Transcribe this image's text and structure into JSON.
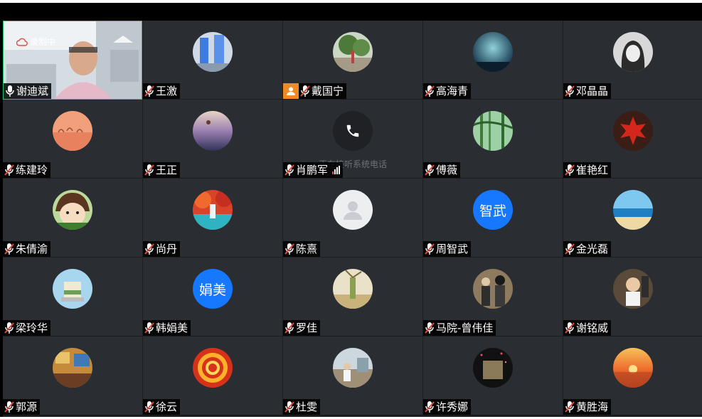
{
  "recording_label": "录制中",
  "calling_status": "正在接听系统电话",
  "participants": [
    {
      "name": "谢迪斌",
      "avatar": "camera-video",
      "speaker": true
    },
    {
      "name": "王激",
      "avatar": "photo-sculpture"
    },
    {
      "name": "戴国宁",
      "avatar": "photo-tree-runner",
      "host": true
    },
    {
      "name": "高海青",
      "avatar": "photo-galaxy"
    },
    {
      "name": "邓晶晶",
      "avatar": "photo-girl-bw"
    },
    {
      "name": "练建玲",
      "avatar": "photo-flamingos"
    },
    {
      "name": "王正",
      "avatar": "photo-balloon-sunset"
    },
    {
      "name": "肖鹏军",
      "avatar": "phone-call",
      "on_phone": true
    },
    {
      "name": "傅薇",
      "avatar": "photo-bamboo"
    },
    {
      "name": "崔艳红",
      "avatar": "photo-red-maple"
    },
    {
      "name": "朱倩渝",
      "avatar": "cartoon-girl"
    },
    {
      "name": "尚丹",
      "avatar": "photo-waterfall"
    },
    {
      "name": "陈熹",
      "avatar": "default-person"
    },
    {
      "name": "周智武",
      "avatar_text": "智武",
      "avatar_color": "#1677ff"
    },
    {
      "name": "金光磊",
      "avatar": "photo-beach"
    },
    {
      "name": "梁玲华",
      "avatar": "photo-cake"
    },
    {
      "name": "韩娟美",
      "avatar_text": "娟美",
      "avatar_color": "#1677ff"
    },
    {
      "name": "罗佳",
      "avatar": "photo-windmill"
    },
    {
      "name": "马院-曾伟佳",
      "avatar": "photo-figures"
    },
    {
      "name": "谢铭威",
      "avatar": "photo-child"
    },
    {
      "name": "郭源",
      "avatar": "photo-room"
    },
    {
      "name": "徐云",
      "avatar": "photo-fire-swirl"
    },
    {
      "name": "杜雯",
      "avatar": "photo-child-outdoor"
    },
    {
      "name": "许秀娜",
      "avatar": "photo-book-night"
    },
    {
      "name": "黄胜海",
      "avatar": "photo-sea-sunset"
    }
  ],
  "colors": {
    "tile_bg": "#2a2d32",
    "grid_bg": "#1b1d20",
    "speaker_border": "#23c26a",
    "muted_red": "#e24c3c",
    "host_orange": "#f08a24",
    "initials_blue": "#1677ff"
  }
}
